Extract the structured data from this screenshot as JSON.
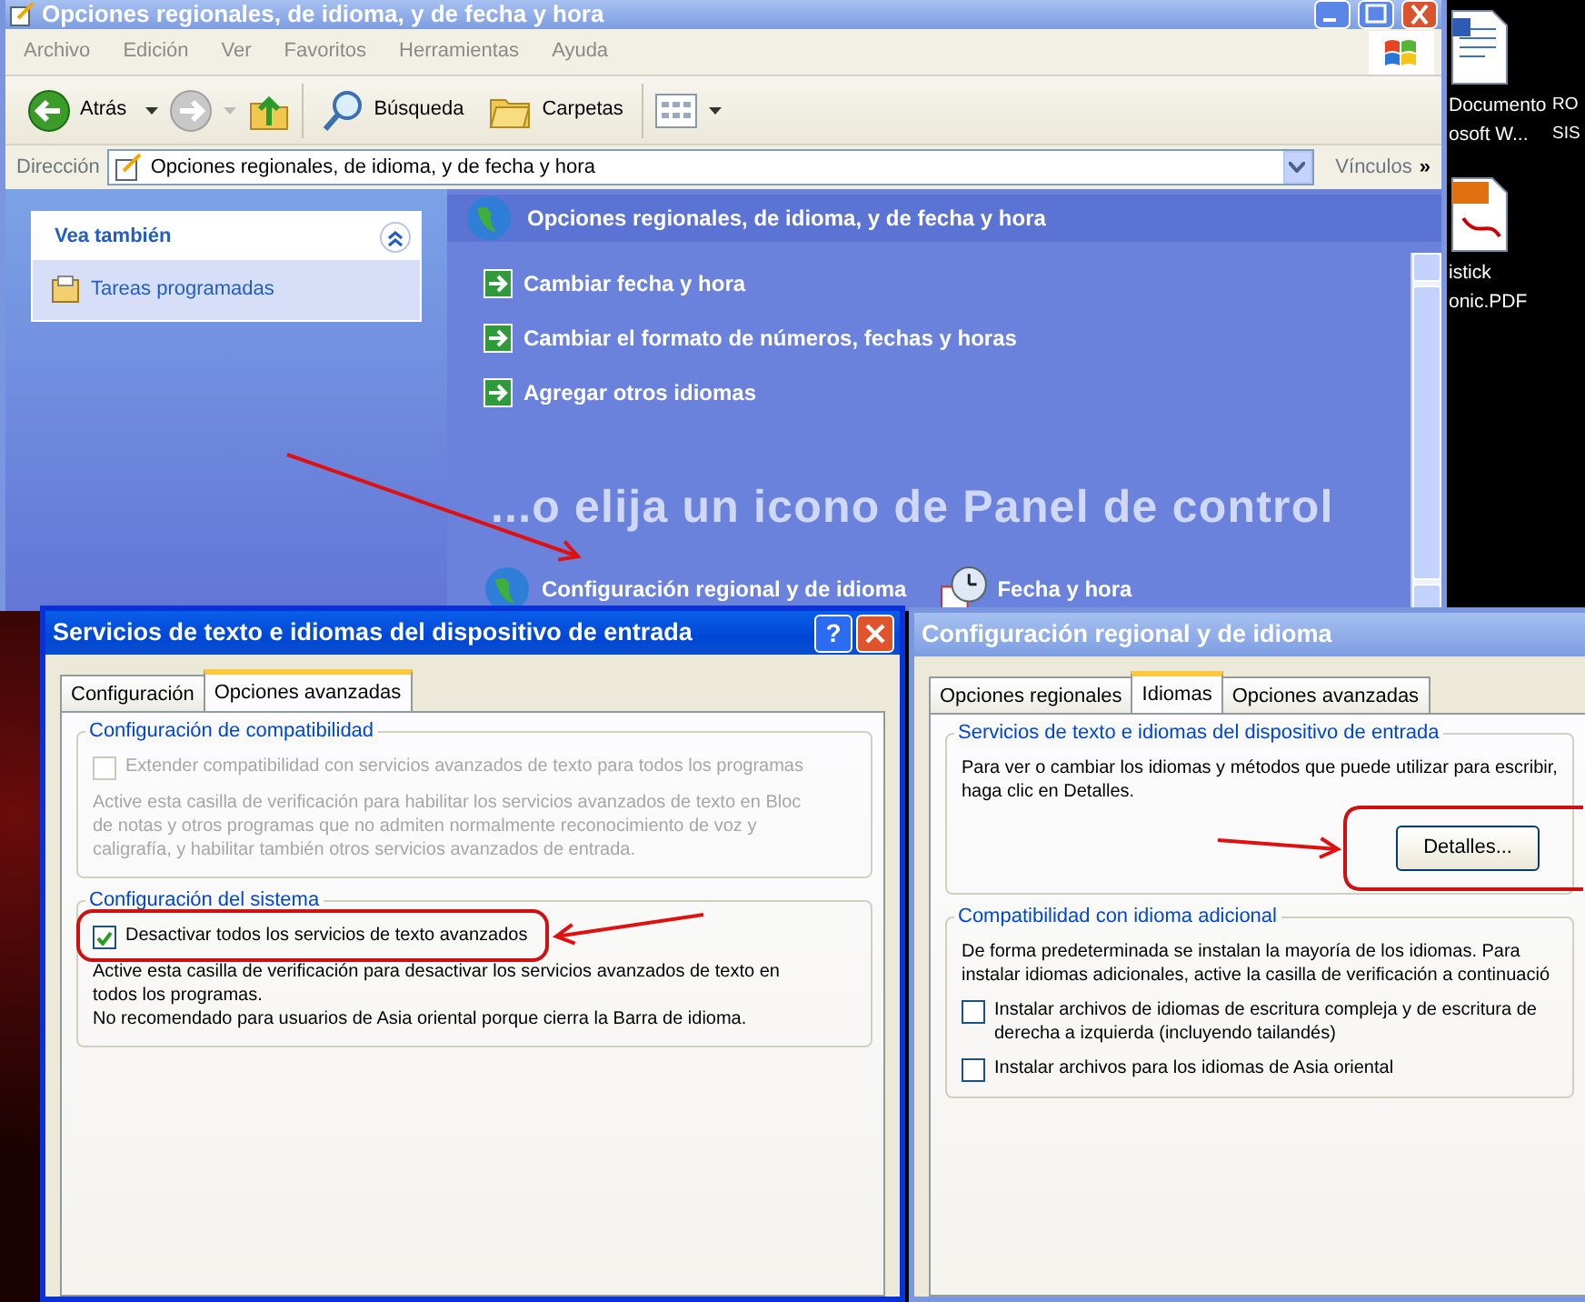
{
  "explorer": {
    "title": "Opciones regionales, de idioma, y de fecha y hora",
    "active": false,
    "menu": [
      "Archivo",
      "Edición",
      "Ver",
      "Favoritos",
      "Herramientas",
      "Ayuda"
    ],
    "toolbar": [
      {
        "kind": "back",
        "label": "Atrás"
      },
      {
        "kind": "forward"
      },
      {
        "kind": "up"
      },
      {
        "kind": "search",
        "label": "Búsqueda"
      },
      {
        "kind": "folders",
        "label": "Carpetas"
      },
      {
        "kind": "views"
      }
    ],
    "address": {
      "label": "Dirección",
      "value": "Opciones regionales, de idioma, y de fecha y hora",
      "links": "Vínculos",
      "more": "»"
    },
    "see_also": {
      "title": "Vea también",
      "expanded": true,
      "items": [
        "Tareas programadas"
      ]
    },
    "header": "Opciones regionales, de idioma, y de fecha y hora",
    "tasks": [
      "Cambiar fecha y hora",
      "Cambiar el formato de números, fechas y horas",
      "Agregar otros idiomas"
    ],
    "pick_heading": "...o elija un icono de Panel de control",
    "icons": [
      {
        "kind": "globe",
        "label": "Configuración regional y de idioma"
      },
      {
        "kind": "clock",
        "label": "Fecha y hora"
      }
    ]
  },
  "desktop_icons": [
    {
      "kind": "document",
      "lines": [
        "Documento",
        "osoft W..."
      ]
    },
    {
      "kind": "pdf",
      "lines": [
        "istick",
        "onic.PDF"
      ]
    },
    {
      "kind": "none",
      "lines": [
        "RO",
        "SIS"
      ]
    }
  ],
  "dialogs": [
    {
      "title": "Servicios de texto e idiomas del dispositivo de entrada",
      "active": true,
      "help": "?",
      "tabs": [
        {
          "label": "Configuración",
          "selected": false
        },
        {
          "label": "Opciones avanzadas",
          "selected": true
        }
      ],
      "groups": [
        {
          "legend": "Configuración de compatibilidad",
          "items": [
            {
              "kind": "checkbox",
              "label": "Extender compatibilidad con servicios avanzados de texto para todos los programas",
              "checked": false,
              "disabled": true
            },
            {
              "kind": "text",
              "text": "Active esta casilla de verificación para habilitar los servicios avanzados de texto en Bloc\nde notas y otros programas que no admiten normalmente reconocimiento de voz y\ncaligrafía, y habilitar también otros servicios avanzados de entrada.",
              "disabled": true
            }
          ]
        },
        {
          "legend": "Configuración del sistema",
          "items": [
            {
              "kind": "checkbox",
              "label": "Desactivar todos los servicios de texto avanzados",
              "checked": true,
              "disabled": false
            },
            {
              "kind": "text",
              "text": "Active esta casilla de verificación para desactivar los servicios avanzados de texto en\ntodos los programas.\nNo recomendado para usuarios de Asia oriental porque cierra la Barra de idioma.",
              "disabled": false
            }
          ]
        }
      ]
    },
    {
      "title": "Configuración regional y de idioma",
      "active": false,
      "tabs": [
        {
          "label": "Opciones regionales",
          "selected": false
        },
        {
          "label": "Idiomas",
          "selected": true
        },
        {
          "label": "Opciones avanzadas",
          "selected": false
        }
      ],
      "groups": [
        {
          "legend": "Servicios de texto e idiomas del dispositivo de entrada",
          "items": [
            {
              "kind": "text",
              "text": "Para ver o cambiar los idiomas y métodos que puede utilizar para escribir,\nhaga clic en Detalles.",
              "disabled": false
            },
            {
              "kind": "button",
              "label": "Detalles..."
            }
          ]
        },
        {
          "legend": "Compatibilidad con idioma adicional",
          "items": [
            {
              "kind": "text",
              "text": "De forma predeterminada se instalan la mayoría de los idiomas. Para\ninstalar idiomas adicionales, active la casilla de verificación a continuació",
              "disabled": false
            },
            {
              "kind": "checkbox",
              "label": "Instalar archivos de idiomas de escritura compleja y de escritura de\nderecha a izquierda (incluyendo tailandés)",
              "checked": false,
              "disabled": false
            },
            {
              "kind": "checkbox",
              "label": "Instalar archivos para los idiomas de Asia oriental",
              "checked": false,
              "disabled": false
            }
          ]
        }
      ]
    }
  ]
}
